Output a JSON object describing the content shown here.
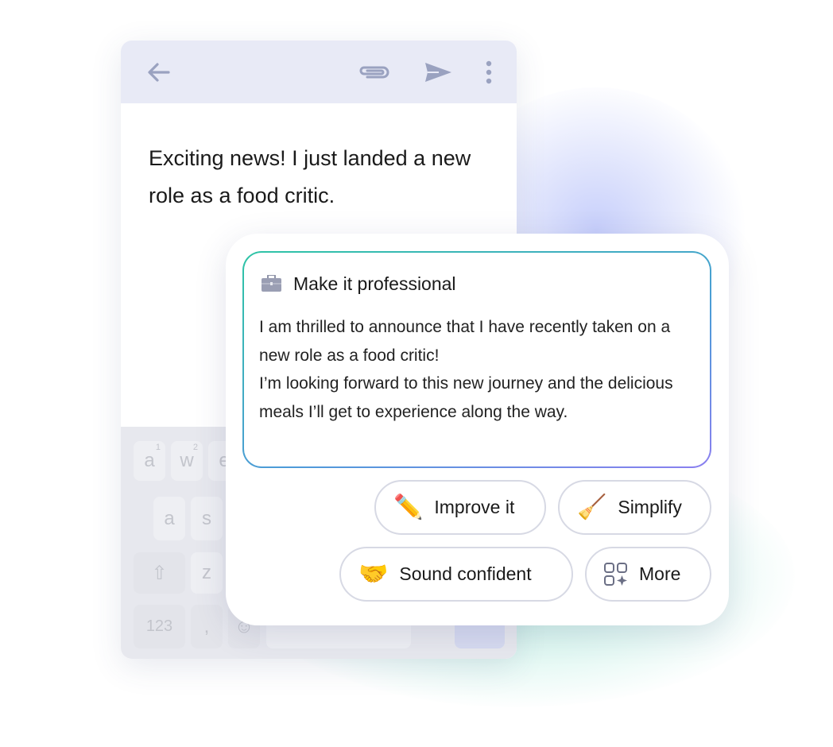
{
  "compose": {
    "header_icons": [
      "back-arrow-icon",
      "paperclip-icon",
      "send-icon",
      "more-vertical-icon"
    ],
    "body": "Exciting news! I just landed a new role as a food critic."
  },
  "keyboard": {
    "row1": [
      {
        "key": "a",
        "hint": "1"
      },
      {
        "key": "w",
        "hint": "2"
      },
      {
        "key": "e",
        "hint": ""
      }
    ],
    "row2": [
      "a",
      "s"
    ],
    "row3": [
      "⇧",
      "z"
    ],
    "row4": [
      "123",
      ",",
      "☺"
    ]
  },
  "suggestion": {
    "icon": "briefcase-icon",
    "title": "Make it professional",
    "text": "I am thrilled to announce that I have recently taken on a new role as a food critic!\nI’m looking forward to this new journey and the delicious meals I’ll get to experience along the way."
  },
  "actions": [
    {
      "label": "Improve it",
      "icon": "pencil-sparkles-icon",
      "glyph": "✏️"
    },
    {
      "label": "Simplify",
      "icon": "broom-icon",
      "glyph": "🧹"
    },
    {
      "label": "Sound confident",
      "icon": "handshake-icon",
      "glyph": "🤝"
    },
    {
      "label": "More",
      "icon": "grid-sparkle-icon",
      "glyph": ""
    }
  ],
  "colors": {
    "header_bg": "#e8eaf6",
    "border_start": "#2ec4a5",
    "border_end": "#8b7ff0"
  }
}
